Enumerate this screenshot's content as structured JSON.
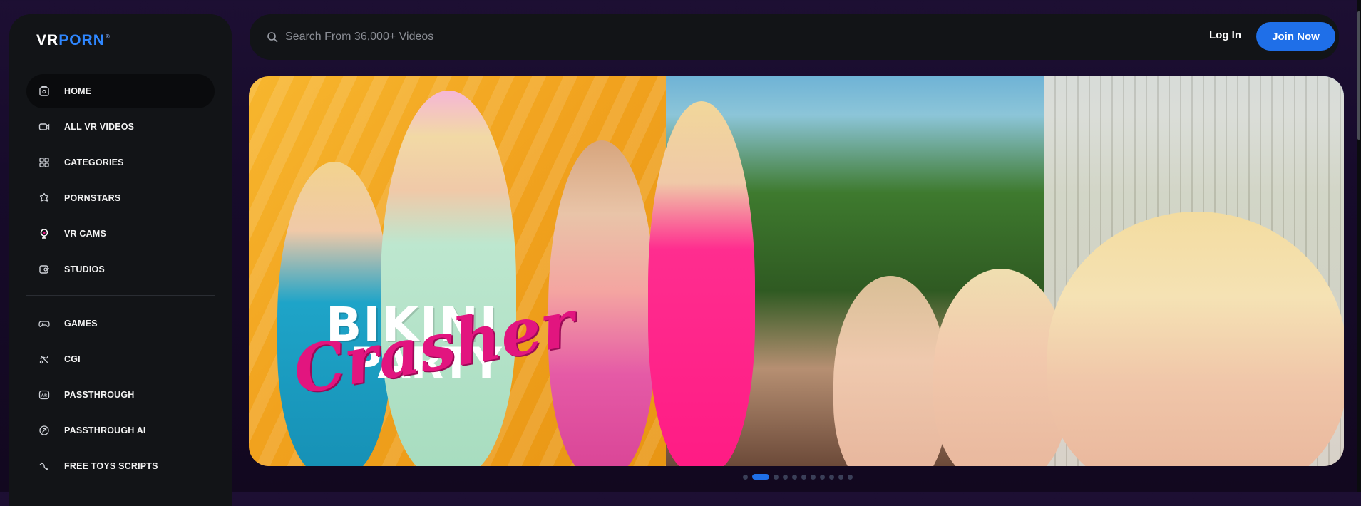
{
  "brand": {
    "logo_prefix": "VR",
    "logo_main": "PORN",
    "logo_mark": "®"
  },
  "search": {
    "placeholder": "Search From 36,000+ Videos",
    "value": ""
  },
  "header": {
    "login_label": "Log In",
    "join_label": "Join Now"
  },
  "sidebar": {
    "primary": [
      {
        "label": "HOME",
        "icon": "home-icon",
        "active": true
      },
      {
        "label": "ALL VR VIDEOS",
        "icon": "video-icon"
      },
      {
        "label": "CATEGORIES",
        "icon": "grid-icon"
      },
      {
        "label": "PORNSTARS",
        "icon": "star-badge-icon"
      },
      {
        "label": "VR CAMS",
        "icon": "webcam-icon"
      },
      {
        "label": "STUDIOS",
        "icon": "studio-icon"
      }
    ],
    "secondary": [
      {
        "label": "GAMES",
        "icon": "gamepad-icon"
      },
      {
        "label": "CGI",
        "icon": "cgi-icon"
      },
      {
        "label": "PASSTHROUGH",
        "icon": "ar-icon"
      },
      {
        "label": "PASSTHROUGH AI",
        "icon": "ai-icon"
      },
      {
        "label": "FREE TOYS SCRIPTS",
        "icon": "toy-icon"
      }
    ]
  },
  "hero": {
    "title_line1": "BIKINI",
    "title_line2": "PARTY",
    "title_line3": "Crasher",
    "slide_count": 11,
    "active_slide": 2
  },
  "colors": {
    "accent": "#1f6fe8",
    "title_pink": "#e2157f",
    "panel": "#121417"
  }
}
